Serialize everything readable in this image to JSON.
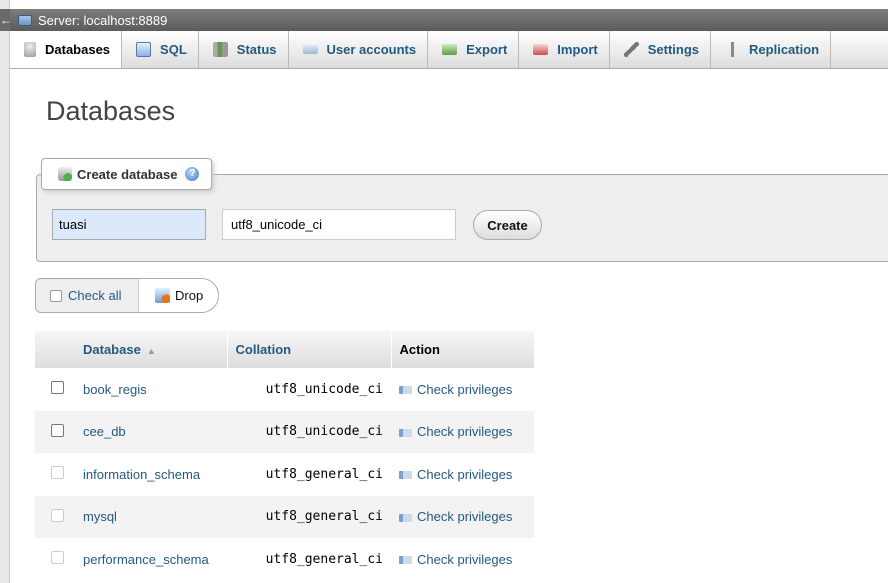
{
  "server_bar": {
    "back": "←",
    "title": "Server: localhost:8889"
  },
  "tabs": [
    {
      "label": "Databases",
      "icon": "database-icon",
      "active": true
    },
    {
      "label": "SQL",
      "icon": "sql-icon"
    },
    {
      "label": "Status",
      "icon": "status-icon"
    },
    {
      "label": "User accounts",
      "icon": "users-icon"
    },
    {
      "label": "Export",
      "icon": "export-icon"
    },
    {
      "label": "Import",
      "icon": "import-icon"
    },
    {
      "label": "Settings",
      "icon": "wrench-icon"
    },
    {
      "label": "Replication",
      "icon": "replication-icon"
    }
  ],
  "page_title": "Databases",
  "create_db": {
    "legend": "Create database",
    "name_value": "tuasi",
    "collation_value": "utf8_unicode_ci",
    "create_label": "Create"
  },
  "bulk": {
    "check_all": "Check all",
    "drop": "Drop"
  },
  "table": {
    "headers": {
      "database": "Database",
      "collation": "Collation",
      "action": "Action"
    },
    "sort_indicator": "▲",
    "rows": [
      {
        "name": "book_regis",
        "collation": "utf8_unicode_ci",
        "action": "Check privileges"
      },
      {
        "name": "cee_db",
        "collation": "utf8_unicode_ci",
        "action": "Check privileges"
      },
      {
        "name": "information_schema",
        "collation": "utf8_general_ci",
        "action": "Check privileges"
      },
      {
        "name": "mysql",
        "collation": "utf8_general_ci",
        "action": "Check privileges"
      },
      {
        "name": "performance_schema",
        "collation": "utf8_general_ci",
        "action": "Check privileges"
      }
    ]
  },
  "colors": {
    "link": "#235a81",
    "active_input_bg": "#dbe9fb",
    "server_bar": "#6a6a6a"
  }
}
